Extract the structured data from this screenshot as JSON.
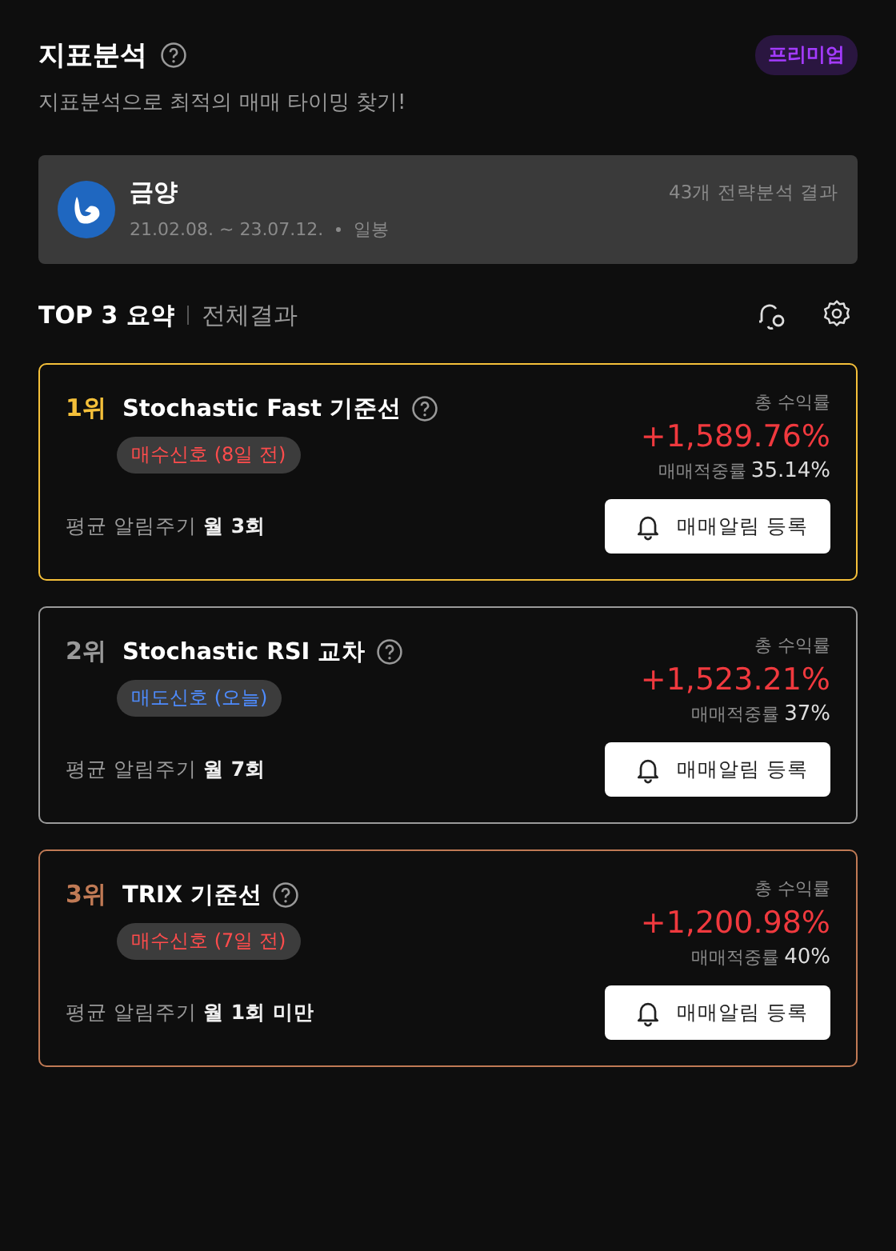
{
  "header": {
    "title": "지표분석",
    "badge": "프리미엄",
    "subtitle": "지표분석으로 최적의 매매 타이밍 찾기!"
  },
  "asset": {
    "name": "금양",
    "period": "21.02.08. ~ 23.07.12.",
    "interval": "일봉",
    "result_count": "43개 전략분석 결과"
  },
  "tabs": [
    {
      "label": "TOP 3 요약",
      "selected": true
    },
    {
      "label": "전체결과",
      "selected": false
    }
  ],
  "strategies": [
    {
      "rank": "1위",
      "color": "#f5c03a",
      "name": "Stochastic Fast 기준선",
      "signal": {
        "kind": "buy",
        "label": "매수신호 (8일 전)"
      },
      "return_label": "총 수익률",
      "return": "+1,589.76%",
      "accuracy_label": "매매적중률",
      "accuracy": "35.14%",
      "frequency_label": "평균 알림주기",
      "frequency": "월 3회",
      "button": "매매알림 등록"
    },
    {
      "rank": "2위",
      "color": "#9a9a9a",
      "name": "Stochastic RSI 교차",
      "signal": {
        "kind": "sell",
        "label": "매도신호 (오늘)"
      },
      "return_label": "총 수익률",
      "return": "+1,523.21%",
      "accuracy_label": "매매적중률",
      "accuracy": "37%",
      "frequency_label": "평균 알림주기",
      "frequency": "월 7회",
      "button": "매매알림 등록"
    },
    {
      "rank": "3위",
      "color": "#c07a55",
      "name": "TRIX 기준선",
      "signal": {
        "kind": "buy",
        "label": "매수신호 (7일 전)"
      },
      "return_label": "총 수익률",
      "return": "+1,200.98%",
      "accuracy_label": "매매적중률",
      "accuracy": "40%",
      "frequency_label": "평균 알림주기",
      "frequency": "월 1회 미만",
      "button": "매매알림 등록"
    }
  ]
}
